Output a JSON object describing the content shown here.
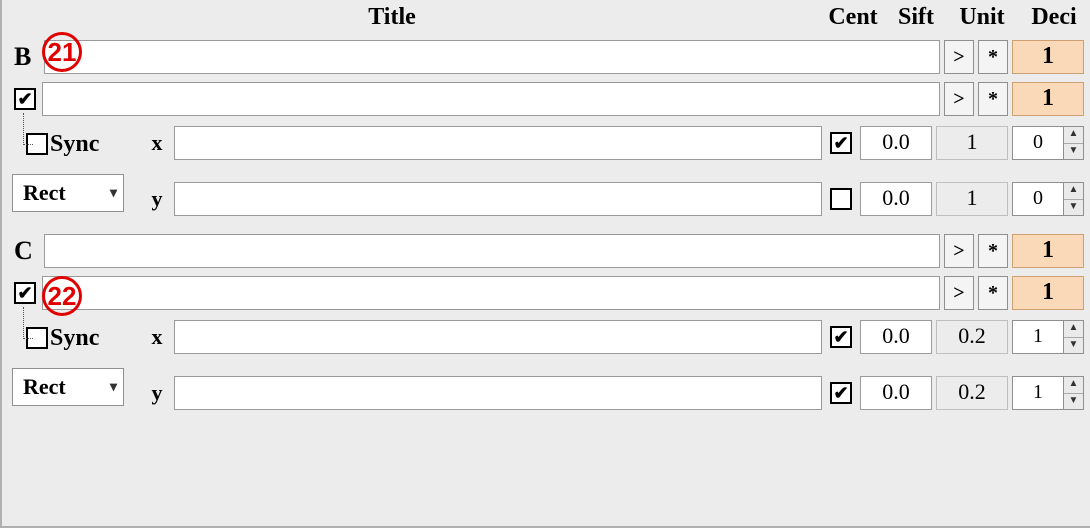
{
  "headers": {
    "title": "Title",
    "cent": "Cent",
    "sift": "Sift",
    "unit": "Unit",
    "deci": "Deci"
  },
  "buttons": {
    "arrow": ">",
    "star": "*"
  },
  "sync_label": "Sync",
  "shape_label": "Rect",
  "axis": {
    "x": "x",
    "y": "y"
  },
  "sections": [
    {
      "letter": "B",
      "row1": {
        "title": "",
        "deci": "1"
      },
      "row2": {
        "title": "",
        "deci": "1",
        "chk_enabled": true
      },
      "sync": false,
      "axes": {
        "x": {
          "title": "",
          "cent": true,
          "sift": "0.0",
          "unit": "1",
          "deci": "0"
        },
        "y": {
          "title": "",
          "cent": false,
          "sift": "0.0",
          "unit": "1",
          "deci": "0"
        }
      }
    },
    {
      "letter": "C",
      "row1": {
        "title": "",
        "deci": "1"
      },
      "row2": {
        "title": "",
        "deci": "1",
        "chk_enabled": true
      },
      "sync": false,
      "axes": {
        "x": {
          "title": "",
          "cent": true,
          "sift": "0.0",
          "unit": "0.2",
          "deci": "1"
        },
        "y": {
          "title": "",
          "cent": true,
          "sift": "0.0",
          "unit": "0.2",
          "deci": "1"
        }
      }
    }
  ],
  "annotations": {
    "a": "21",
    "b": "22"
  }
}
